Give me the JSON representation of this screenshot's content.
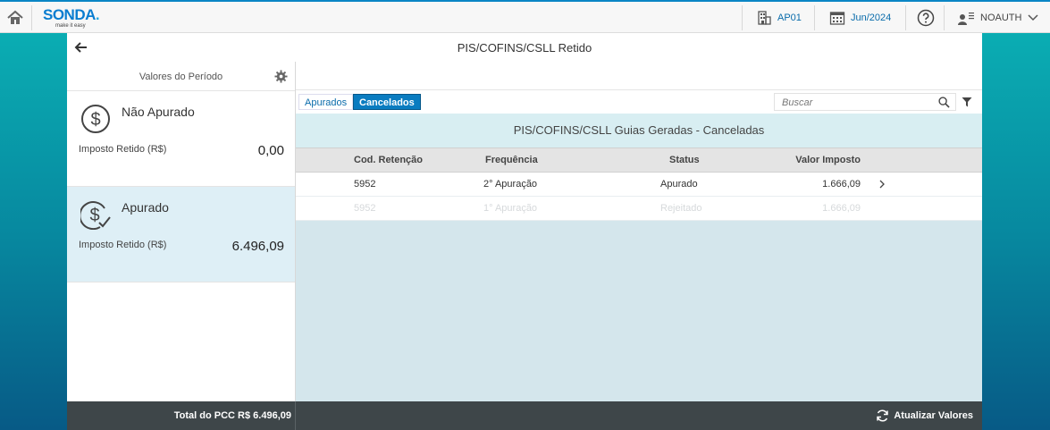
{
  "topbar": {
    "logo_name": "SONDA",
    "logo_dot": ".",
    "logo_tagline": "make it easy",
    "company": "AP01",
    "period": "Jun/2024",
    "user": "NOAUTH"
  },
  "page": {
    "title": "PIS/COFINS/CSLL Retido"
  },
  "left": {
    "header": "Valores do Período",
    "cards": [
      {
        "title": "Não Apurado",
        "label": "Imposto Retido (R$)",
        "value": "0,00"
      },
      {
        "title": "Apurado",
        "label": "Imposto Retido (R$)",
        "value": "6.496,09"
      }
    ]
  },
  "tabs": {
    "apurados": "Apurados",
    "cancelados": "Cancelados"
  },
  "search": {
    "placeholder": "Buscar"
  },
  "banner": "PIS/COFINS/CSLL Guias Geradas - Canceladas",
  "table": {
    "headers": [
      "Cod. Retenção",
      "Frequência",
      "Status",
      "Valor Imposto"
    ],
    "rows": [
      [
        "5952",
        "2° Apuração",
        "Apurado",
        "1.666,09"
      ],
      [
        "5952",
        "1° Apuração",
        "Rejeitado",
        "1.666,09"
      ]
    ]
  },
  "footer": {
    "total": "Total do PCC  R$ 6.496,09",
    "refresh": "Atualizar Valores"
  },
  "colors": {
    "brand": "#0a7dd0",
    "accent": "#0a7cc0",
    "footer_bg": "#3e4649"
  }
}
